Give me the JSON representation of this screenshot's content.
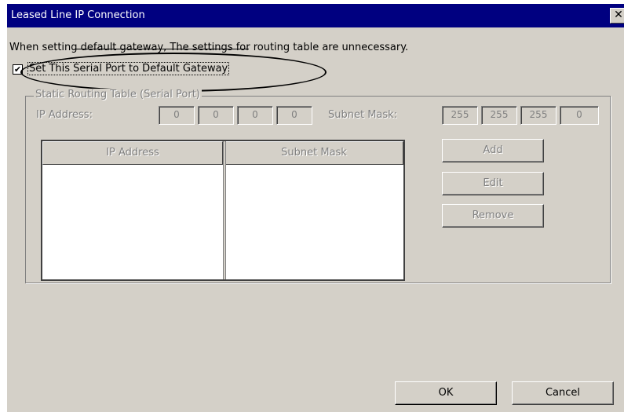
{
  "window": {
    "title": "Leased Line IP Connection",
    "close_glyph": "✕"
  },
  "info_text": "When setting default gateway, The settings for routing table are unnecessary.",
  "default_gateway": {
    "label": "Set This Serial Port to Default Gateway",
    "checked": true,
    "check_glyph": "✔"
  },
  "routing_group": {
    "legend": "Static Routing Table (Serial Port)",
    "ip_label": "IP Address:",
    "mask_label": "Subnet Mask:",
    "ip_octets": [
      "0",
      "0",
      "0",
      "0"
    ],
    "mask_octets": [
      "255",
      "255",
      "255",
      "0"
    ],
    "table_headers": [
      "IP Address",
      "Subnet Mask"
    ],
    "rows": [],
    "add_label": "Add",
    "edit_label": "Edit",
    "remove_label": "Remove"
  },
  "buttons": {
    "ok": "OK",
    "cancel": "Cancel"
  }
}
